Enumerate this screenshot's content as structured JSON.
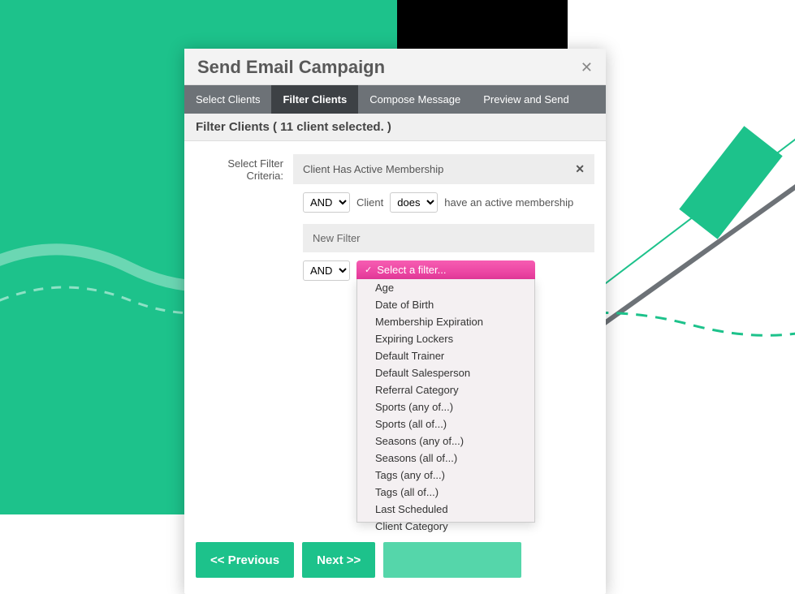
{
  "modal": {
    "title": "Send Email Campaign"
  },
  "tabs": {
    "t0": "Select Clients",
    "t1": "Filter Clients",
    "t2": "Compose Message",
    "t3": "Preview and Send"
  },
  "section": {
    "header": "Filter Clients ( 11 client selected. )"
  },
  "criteria": {
    "label": "Select Filter Criteria:",
    "active_filter": "Client Has Active Membership",
    "op_and": "AND",
    "client_word": "Client",
    "does_option": "does",
    "membership_text": "have an active membership",
    "new_filter_label": "New Filter",
    "select_placeholder": "Select a filter..."
  },
  "filter_options": [
    "Age",
    "Date of Birth",
    "Membership Expiration",
    "Expiring Lockers",
    "Default Trainer",
    "Default Salesperson",
    "Referral Category",
    "Sports (any of...)",
    "Sports (all of...)",
    "Seasons (any of...)",
    "Seasons (all of...)",
    "Tags (any of...)",
    "Tags (all of...)",
    "Last Scheduled",
    "Client Category"
  ],
  "buttons": {
    "prev": "<< Previous",
    "next": "Next >>"
  }
}
